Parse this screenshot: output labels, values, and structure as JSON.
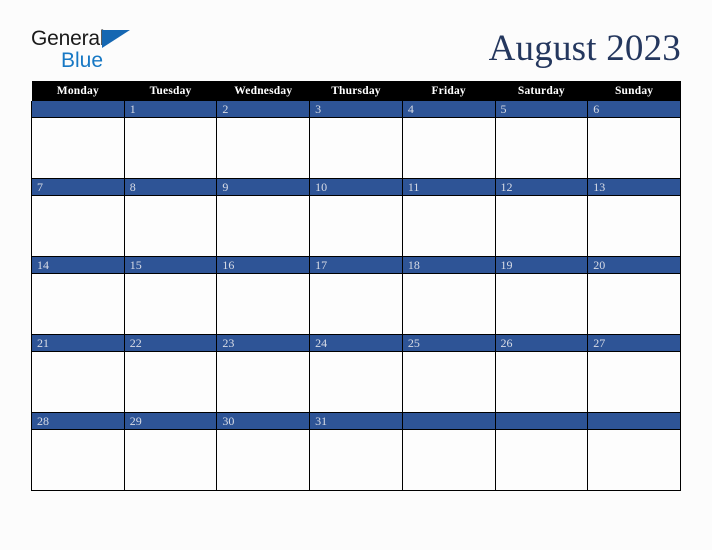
{
  "brand": {
    "name_line1": "General",
    "name_line2": "Blue",
    "triangle_color": "#1567b2",
    "line1_color": "#1a1a1a",
    "line2_color": "#1778c4"
  },
  "header": {
    "title": "August 2023",
    "title_color": "#24375e"
  },
  "calendar": {
    "weekday_headers": [
      "Monday",
      "Tuesday",
      "Wednesday",
      "Thursday",
      "Friday",
      "Saturday",
      "Sunday"
    ],
    "header_bg": "#000000",
    "header_text_color": "#ffffff",
    "daynum_bg": "#2e5496",
    "daynum_text_color": "#d8dce6",
    "cell_bg": "#fdfdfd",
    "grid_line_color": "#000000",
    "weeks": [
      [
        "",
        "1",
        "2",
        "3",
        "4",
        "5",
        "6"
      ],
      [
        "7",
        "8",
        "9",
        "10",
        "11",
        "12",
        "13"
      ],
      [
        "14",
        "15",
        "16",
        "17",
        "18",
        "19",
        "20"
      ],
      [
        "21",
        "22",
        "23",
        "24",
        "25",
        "26",
        "27"
      ],
      [
        "28",
        "29",
        "30",
        "31",
        "",
        "",
        ""
      ]
    ]
  },
  "page": {
    "background": "#fcfcfc"
  }
}
